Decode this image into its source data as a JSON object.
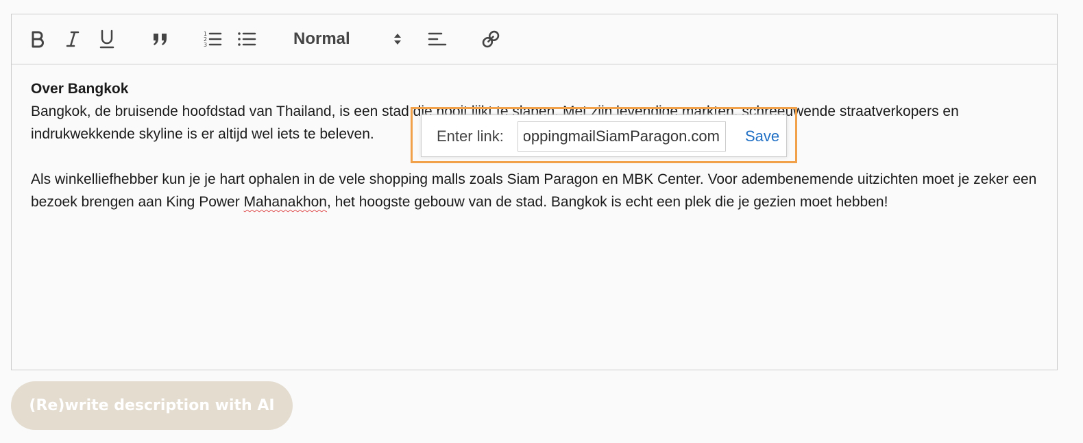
{
  "toolbar": {
    "header_value": "Normal"
  },
  "content": {
    "heading": "Over Bangkok",
    "paragraph1": "Bangkok, de bruisende hoofdstad van Thailand, is een stad die nooit lijkt te slapen. Met zijn levendige markten, schreeuwende straatverkopers en indrukwekkende skyline is er altijd wel iets te beleven.",
    "paragraph2_before": "Als winkelliefhebber kun je je hart ophalen in de vele shopping malls zoals Siam Paragon en MBK Center. Voor adembenemende uitzichten moet je zeker een bezoek brengen aan King Power ",
    "paragraph2_misspelled": "Mahanakhon",
    "paragraph2_after": ", het hoogste gebouw van de stad. Bangkok is echt een plek die je gezien moet hebben!"
  },
  "link_tooltip": {
    "label": "Enter link:",
    "value": "shoppingmailSiamParagon.com",
    "save_label": "Save"
  },
  "ai_button": {
    "label": "(Re)write description with AI"
  },
  "colors": {
    "tooltip_highlight": "#f0a14a",
    "save_link": "#1f6fc5",
    "ai_button_bg": "#e3dccf"
  }
}
